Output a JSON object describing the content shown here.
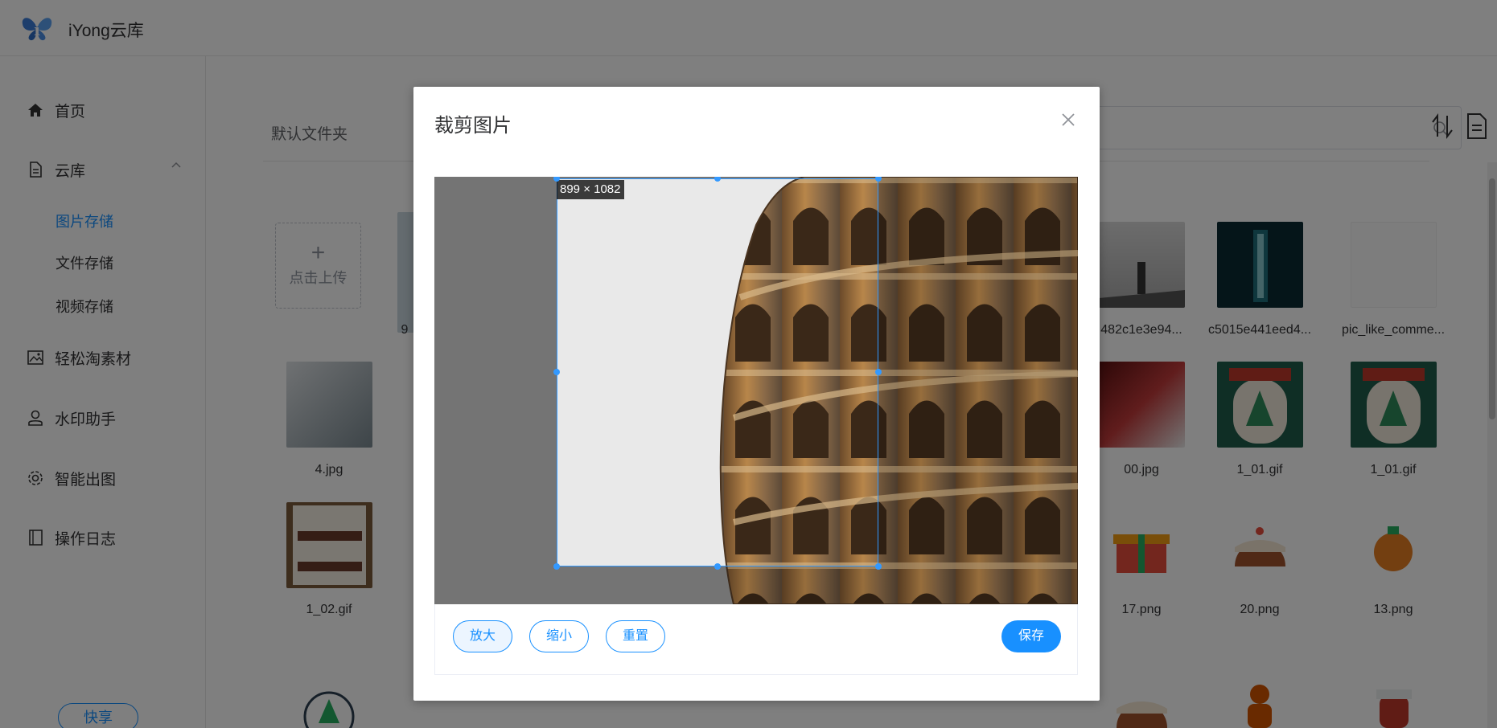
{
  "app": {
    "title": "iYong云库"
  },
  "sidebar": {
    "items": [
      {
        "label": "首页",
        "icon": "home-icon"
      },
      {
        "label": "云库",
        "icon": "document-icon"
      },
      {
        "label": "轻松淘素材",
        "icon": "image-icon"
      },
      {
        "label": "水印助手",
        "icon": "user-icon"
      },
      {
        "label": "智能出图",
        "icon": "gear-icon"
      },
      {
        "label": "操作日志",
        "icon": "log-book-icon"
      }
    ],
    "sub_items": [
      {
        "label": "图片存储",
        "active": true
      },
      {
        "label": "文件存储",
        "active": false
      },
      {
        "label": "视频存储",
        "active": false
      }
    ],
    "share_label": "快享"
  },
  "main": {
    "folder_title": "默认文件夹",
    "upload_label": "点击上传",
    "tiles": [
      {
        "label": "482c1e3e94..."
      },
      {
        "label": "c5015e441eed4..."
      },
      {
        "label": "pic_like_comme..."
      },
      {
        "label": "4.jpg"
      },
      {
        "label": "00.jpg"
      },
      {
        "label": "1_01.gif"
      },
      {
        "label": "1_01.gif"
      },
      {
        "label": "1_02.gif"
      },
      {
        "label": "17.png"
      },
      {
        "label": "20.png"
      },
      {
        "label": "13.png"
      }
    ],
    "partial_label": "9"
  },
  "dialog": {
    "title": "裁剪图片",
    "crop_size": "899 × 1082",
    "buttons": {
      "zoom_in": "放大",
      "zoom_out": "缩小",
      "reset": "重置",
      "save": "保存"
    }
  },
  "colors": {
    "accent": "#1890ff",
    "overlay": "rgba(0,0,0,0.5)"
  }
}
